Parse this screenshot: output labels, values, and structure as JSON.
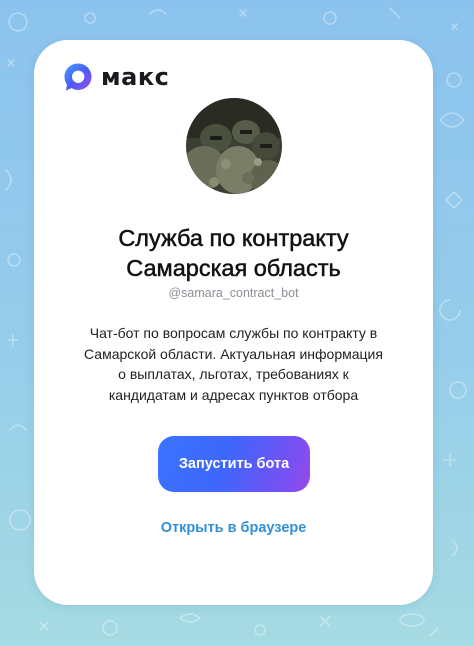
{
  "app": {
    "logo_text": "макс",
    "logo_icon": "max-logo-icon"
  },
  "bot": {
    "title_line1": "Служба по контракту",
    "title_line2": "Самарская область",
    "username": "@samara_contract_bot",
    "description_lines": [
      "Чат-бот по вопросам службы по контракту в",
      "Самарской области. Актуальная информация",
      "о выплатах, льготах, требованиях к",
      "кандидатам и адресах пунктов отбора"
    ]
  },
  "actions": {
    "start_label": "Запустить бота",
    "open_browser_label": "Открыть в браузере"
  },
  "colors": {
    "accent_blue": "#3a74ff",
    "accent_purple": "#9a4ae6",
    "link": "#2f8fd8",
    "background": "#8cc3ee"
  }
}
